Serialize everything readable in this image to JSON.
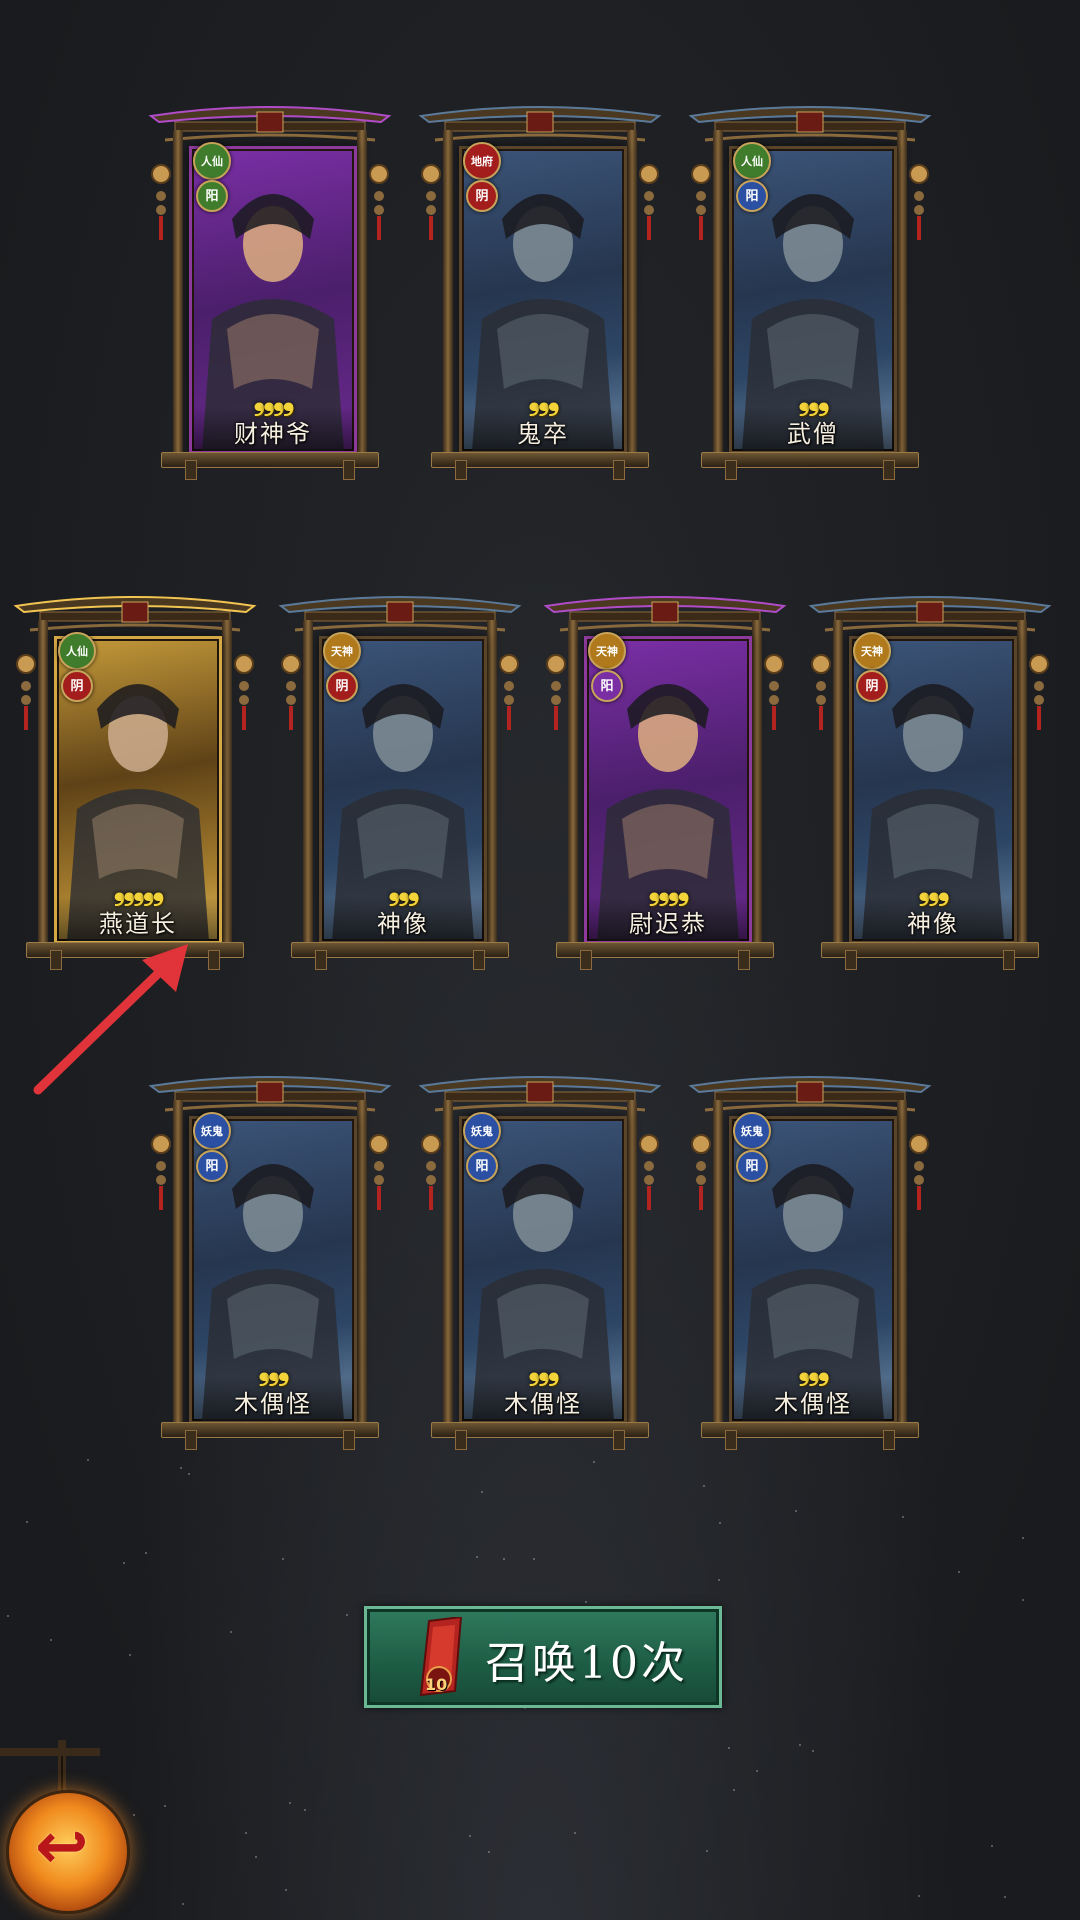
{
  "cards": [
    {
      "name": "财神爷",
      "stars": 4,
      "rarity": "purple",
      "badge_top": "人仙",
      "badge_top_color": "#3f7d2c",
      "badge_bottom": "阳",
      "badge_bottom_color": "#3f7d2c"
    },
    {
      "name": "鬼卒",
      "stars": 3,
      "rarity": "blue",
      "badge_top": "地府",
      "badge_top_color": "#a31d1d",
      "badge_bottom": "阴",
      "badge_bottom_color": "#a31d1d"
    },
    {
      "name": "武僧",
      "stars": 3,
      "rarity": "blue",
      "badge_top": "人仙",
      "badge_top_color": "#3f7d2c",
      "badge_bottom": "阳",
      "badge_bottom_color": "#2a4fa3"
    },
    {
      "name": "燕道长",
      "stars": 5,
      "rarity": "gold",
      "badge_top": "人仙",
      "badge_top_color": "#3f7d2c",
      "badge_bottom": "阴",
      "badge_bottom_color": "#a31d1d"
    },
    {
      "name": "神像",
      "stars": 3,
      "rarity": "blue",
      "badge_top": "天神",
      "badge_top_color": "#b07a1c",
      "badge_bottom": "阴",
      "badge_bottom_color": "#a31d1d"
    },
    {
      "name": "尉迟恭",
      "stars": 4,
      "rarity": "purple",
      "badge_top": "天神",
      "badge_top_color": "#b07a1c",
      "badge_bottom": "阳",
      "badge_bottom_color": "#7a2ea3"
    },
    {
      "name": "神像",
      "stars": 3,
      "rarity": "blue",
      "badge_top": "天神",
      "badge_top_color": "#b07a1c",
      "badge_bottom": "阴",
      "badge_bottom_color": "#a31d1d"
    },
    {
      "name": "木偶怪",
      "stars": 3,
      "rarity": "blue",
      "badge_top": "妖鬼",
      "badge_top_color": "#2a4fa3",
      "badge_bottom": "阳",
      "badge_bottom_color": "#2a4fa3"
    },
    {
      "name": "木偶怪",
      "stars": 3,
      "rarity": "blue",
      "badge_top": "妖鬼",
      "badge_top_color": "#2a4fa3",
      "badge_bottom": "阳",
      "badge_bottom_color": "#2a4fa3"
    },
    {
      "name": "木偶怪",
      "stars": 3,
      "rarity": "blue",
      "badge_top": "妖鬼",
      "badge_top_color": "#2a4fa3",
      "badge_bottom": "阳",
      "badge_bottom_color": "#2a4fa3"
    }
  ],
  "summon_button": {
    "label": "召唤10次",
    "token_icon": "summon-scroll-icon",
    "token_count": "10"
  },
  "back_button": {
    "icon": "back-arrow-icon",
    "glyph": "↩"
  },
  "colors": {
    "star": "#f2d33a",
    "arrow": "#e0343a",
    "summon_bg": "#1d5c44"
  }
}
